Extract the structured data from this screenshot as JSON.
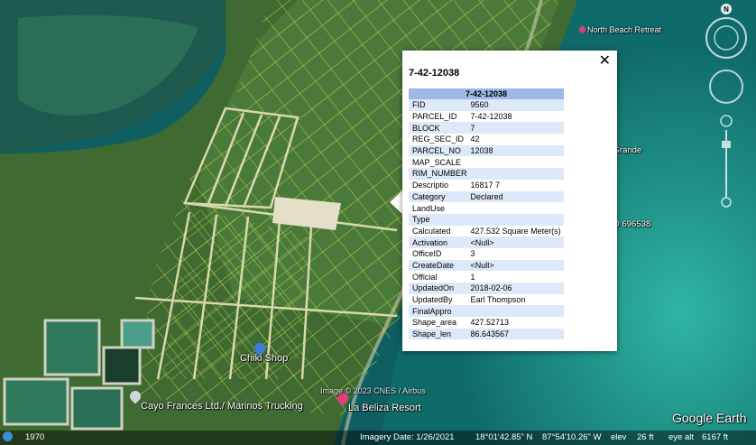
{
  "map": {
    "places": [
      {
        "name": "North Beach Retreat",
        "pin_color": "#e0407a"
      },
      {
        "name": "Away Casa Grande"
      },
      {
        "name": "y Belize VRBO 696538"
      },
      {
        "name": "Chiki Shop",
        "pin_color": "#3b7de0"
      },
      {
        "name": "Cayo Frances Ltd./ Marinos Trucking",
        "pin_color": "#cfd8dc"
      },
      {
        "name": "La Beliza Resort",
        "pin_color": "#e0407a"
      }
    ],
    "imagery_credit": "Image © 2023 CNES / Airbus",
    "logo": "Google Earth",
    "compass_letter": "N"
  },
  "popup": {
    "title": "7-42-12038",
    "close_glyph": "✕",
    "table_header": "7-42-12038",
    "rows": [
      {
        "key": "FID",
        "value": "9560"
      },
      {
        "key": "PARCEL_ID",
        "value": "7-42-12038"
      },
      {
        "key": "BLOCK",
        "value": "7"
      },
      {
        "key": "REG_SEC_ID",
        "value": "42"
      },
      {
        "key": "PARCEL_NO",
        "value": "12038"
      },
      {
        "key": "MAP_SCALE",
        "value": ""
      },
      {
        "key": "RIM_NUMBER",
        "value": ""
      },
      {
        "key": "Descriptio",
        "value": "16817 7"
      },
      {
        "key": "Category",
        "value": "Declared"
      },
      {
        "key": "LandUse",
        "value": ""
      },
      {
        "key": "Type",
        "value": ""
      },
      {
        "key": "Calculated",
        "value": "427.532 Square Meter(s)"
      },
      {
        "key": "Activation",
        "value": "<Null>"
      },
      {
        "key": "OfficeID",
        "value": "3"
      },
      {
        "key": "CreateDate",
        "value": "<Null>"
      },
      {
        "key": "Official",
        "value": "1"
      },
      {
        "key": "UpdatedOn",
        "value": "2018-02-06"
      },
      {
        "key": "UpdatedBy",
        "value": "Earl Thompson"
      },
      {
        "key": "FinalAppro",
        "value": ""
      },
      {
        "key": "Shape_area",
        "value": "427.52713"
      },
      {
        "key": "Shape_len",
        "value": "86.643567"
      }
    ]
  },
  "status": {
    "year": "1970",
    "imagery_date": "Imagery Date: 1/26/2021",
    "lat": "18°01'42.85\" N",
    "lon": "87°54'10.26\" W",
    "elev_label": "elev",
    "elev": "26 ft",
    "eye_alt_label": "eye alt",
    "eye_alt": "6167 ft"
  }
}
